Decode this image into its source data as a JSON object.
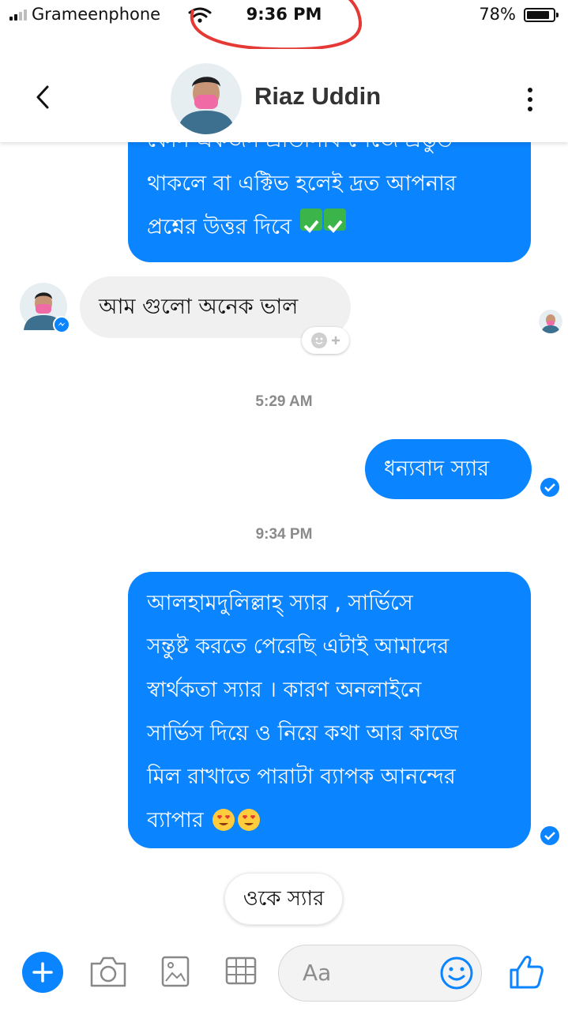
{
  "status_bar": {
    "carrier": "Grameenphone",
    "time": "9:36 PM",
    "battery": "78%",
    "battery_level": 0.78
  },
  "header": {
    "contact_name": "Riaz Uddin"
  },
  "messages": [
    {
      "direction": "outgoing",
      "lines": [
        "কোন একজন প্রতিনিধি পেজে প্রস্তুত",
        "থাকলে বা এক্টিভ হলেই দ্রত আপনার",
        "প্রশ্নের উত্তর দিবে"
      ],
      "emoji": "✅✅"
    },
    {
      "direction": "incoming",
      "lines": [
        "আম গুলো অনেক ভাল"
      ]
    },
    {
      "timestamp": "5:29 AM"
    },
    {
      "direction": "outgoing",
      "lines": [
        "ধন্যবাদ স্যার"
      ]
    },
    {
      "timestamp": "9:34 PM"
    },
    {
      "direction": "outgoing",
      "lines": [
        "আলহামদুলিল্লাহ্ স্যার , সার্ভিসে",
        "সন্তুষ্ট করতে পেরেছি এটাই আমাদের",
        "স্বার্থকতা স্যার । কারণ অনলাইনে",
        "সার্ভিস দিয়ে ও নিয়ে কথা আর কাজে",
        "মিল রাখাতে পারাটা ব্যাপক আনন্দের",
        "ব্যাপার"
      ],
      "emoji": "😍😍"
    }
  ],
  "quick_reply": "ওকে স্যার",
  "composer": {
    "placeholder": "Aa"
  },
  "colors": {
    "accent": "#0a84ff",
    "incoming_bubble": "#f0f0f0",
    "annotation": "#e53935"
  },
  "icons": [
    "wifi-icon",
    "back-icon",
    "more-icon",
    "add-icon",
    "camera-icon",
    "photo-icon",
    "sticker-icon",
    "emoji-icon",
    "like-icon",
    "seen-check-icon",
    "messenger-badge-icon"
  ]
}
